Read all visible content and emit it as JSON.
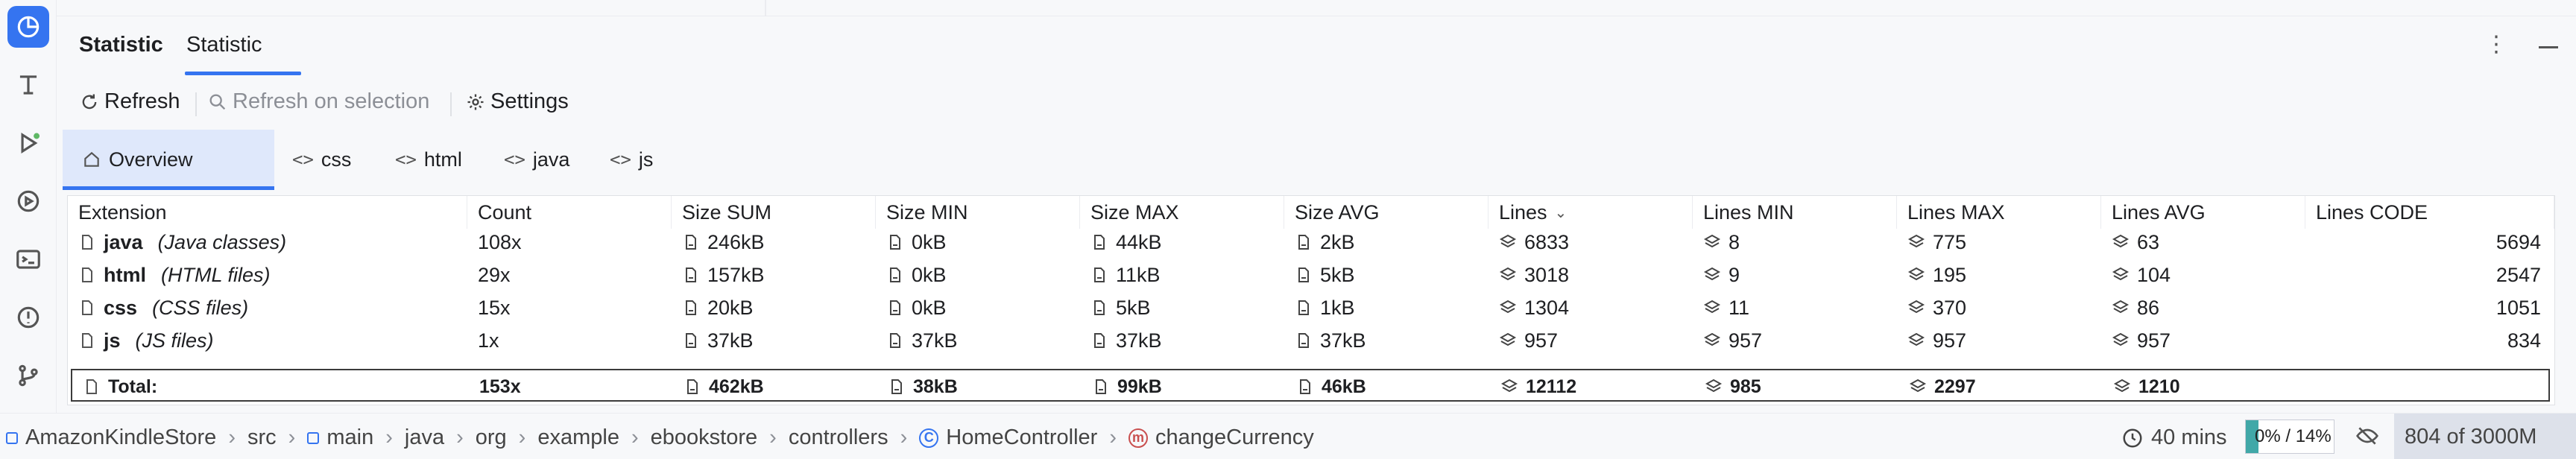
{
  "toolstrip": {
    "icons": [
      "statistic-icon",
      "structure-icon",
      "run-icon",
      "services-icon",
      "terminal-icon",
      "problems-icon",
      "git-icon"
    ]
  },
  "header": {
    "title": "Statistic",
    "tab": "Statistic",
    "menu": "⋮"
  },
  "toolbar": {
    "refresh": "Refresh",
    "refresh_on_selection": "Refresh on selection",
    "settings": "Settings"
  },
  "subtabs": [
    {
      "label": "Overview",
      "icon": "home-icon"
    },
    {
      "label": "css",
      "icon": "code-icon"
    },
    {
      "label": "html",
      "icon": "code-icon"
    },
    {
      "label": "java",
      "icon": "code-icon"
    },
    {
      "label": "js",
      "icon": "code-icon"
    }
  ],
  "table": {
    "columns": [
      "Extension",
      "Count",
      "Size SUM",
      "Size MIN",
      "Size MAX",
      "Size AVG",
      "Lines",
      "Lines MIN",
      "Lines MAX",
      "Lines AVG",
      "Lines CODE"
    ],
    "rows": [
      {
        "name": "java",
        "desc": "(Java classes)",
        "count": "108x",
        "size_sum": "246kB",
        "size_min": "0kB",
        "size_max": "44kB",
        "size_avg": "2kB",
        "lines": "6833",
        "lines_min": "8",
        "lines_max": "775",
        "lines_avg": "63",
        "lines_code": "5694"
      },
      {
        "name": "html",
        "desc": "(HTML files)",
        "count": "29x",
        "size_sum": "157kB",
        "size_min": "0kB",
        "size_max": "11kB",
        "size_avg": "5kB",
        "lines": "3018",
        "lines_min": "9",
        "lines_max": "195",
        "lines_avg": "104",
        "lines_code": "2547"
      },
      {
        "name": "css",
        "desc": "(CSS files)",
        "count": "15x",
        "size_sum": "20kB",
        "size_min": "0kB",
        "size_max": "5kB",
        "size_avg": "1kB",
        "lines": "1304",
        "lines_min": "11",
        "lines_max": "370",
        "lines_avg": "86",
        "lines_code": "1051"
      },
      {
        "name": "js",
        "desc": "(JS files)",
        "count": "1x",
        "size_sum": "37kB",
        "size_min": "37kB",
        "size_max": "37kB",
        "size_avg": "37kB",
        "lines": "957",
        "lines_min": "957",
        "lines_max": "957",
        "lines_avg": "957",
        "lines_code": "834"
      }
    ],
    "total": {
      "label": "Total:",
      "count": "153x",
      "size_sum": "462kB",
      "size_min": "38kB",
      "size_max": "99kB",
      "size_avg": "46kB",
      "lines": "12112",
      "lines_min": "985",
      "lines_max": "2297",
      "lines_avg": "1210",
      "lines_code": ""
    }
  },
  "statusbar": {
    "breadcrumbs": [
      "AmazonKindleStore",
      "src",
      "main",
      "java",
      "org",
      "example",
      "ebookstore",
      "controllers",
      "HomeController",
      "changeCurrency"
    ],
    "time": "40 mins",
    "memory_text": "0% / 14%",
    "memory_fraction": 0.14,
    "heap": "804 of 3000M"
  }
}
